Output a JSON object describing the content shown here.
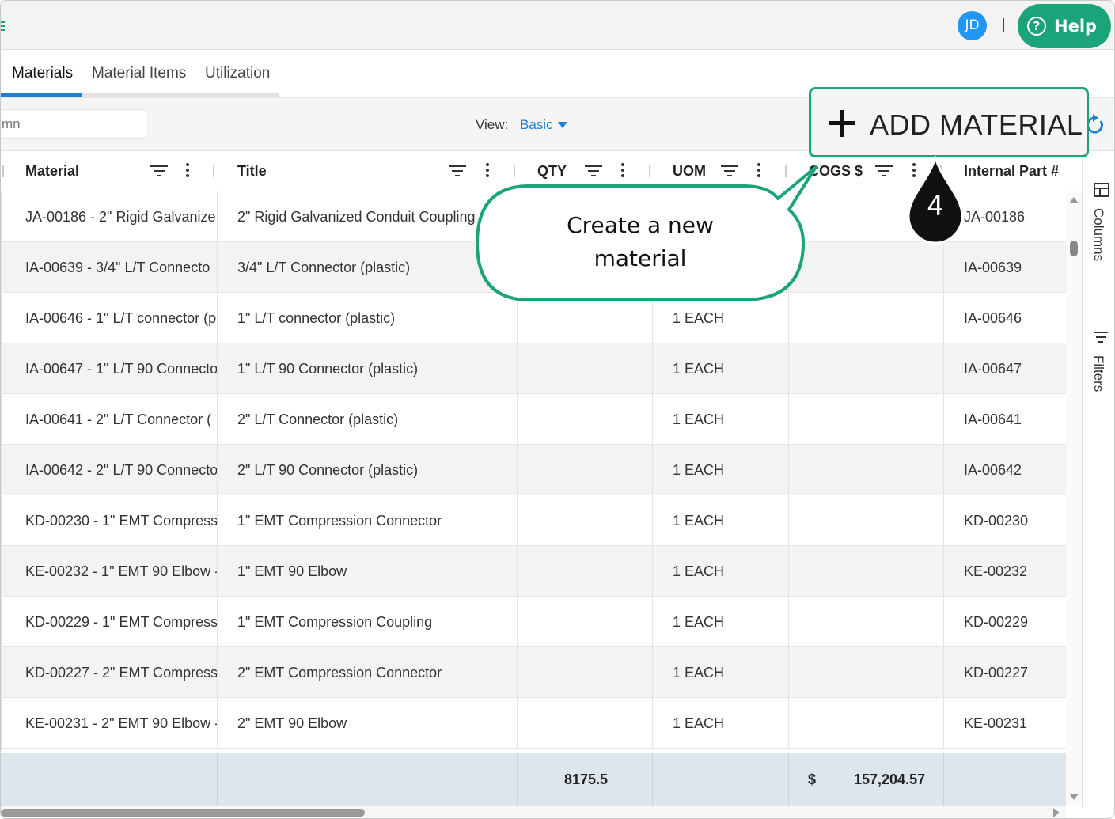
{
  "header": {
    "avatar_initials": "JD",
    "help_label": "Help"
  },
  "tabs": [
    {
      "label": "Materials",
      "active": true
    },
    {
      "label": "Material Items",
      "active": false
    },
    {
      "label": "Utilization",
      "active": false
    }
  ],
  "toolbar": {
    "search_placeholder": "mn",
    "view_label": "View:",
    "view_value": "Basic",
    "add_button_label": "ADD MATERIAL"
  },
  "columns": [
    "Material",
    "Title",
    "QTY",
    "UOM",
    "COGS $",
    "Internal Part #"
  ],
  "rows": [
    {
      "material": "JA-00186 - 2\" Rigid Galvanize",
      "title": "2\" Rigid Galvanized Conduit Coupling",
      "qty": "",
      "uom": "",
      "cogs": "",
      "part": "JA-00186"
    },
    {
      "material": "IA-00639 - 3/4\" L/T Connecto",
      "title": "3/4\" L/T Connector (plastic)",
      "qty": "",
      "uom": "",
      "cogs": "",
      "part": "IA-00639"
    },
    {
      "material": "IA-00646 - 1\" L/T connector (p",
      "title": "1\" L/T connector (plastic)",
      "qty": "",
      "uom": "1 EACH",
      "cogs": "",
      "part": "IA-00646"
    },
    {
      "material": "IA-00647 - 1\" L/T 90 Connecto",
      "title": "1\" L/T 90 Connector (plastic)",
      "qty": "",
      "uom": "1 EACH",
      "cogs": "",
      "part": "IA-00647"
    },
    {
      "material": "IA-00641 - 2\" L/T Connector (",
      "title": "2\" L/T Connector (plastic)",
      "qty": "",
      "uom": "1 EACH",
      "cogs": "",
      "part": "IA-00641"
    },
    {
      "material": "IA-00642 - 2\" L/T 90 Connecto",
      "title": "2\" L/T 90 Connector (plastic)",
      "qty": "",
      "uom": "1 EACH",
      "cogs": "",
      "part": "IA-00642"
    },
    {
      "material": "KD-00230 - 1\" EMT Compress",
      "title": "1\" EMT Compression Connector",
      "qty": "",
      "uom": "1 EACH",
      "cogs": "",
      "part": "KD-00230"
    },
    {
      "material": "KE-00232 - 1\" EMT 90 Elbow -",
      "title": "1\" EMT 90 Elbow",
      "qty": "",
      "uom": "1 EACH",
      "cogs": "",
      "part": "KE-00232"
    },
    {
      "material": "KD-00229 - 1\" EMT Compress",
      "title": "1\" EMT Compression Coupling",
      "qty": "",
      "uom": "1 EACH",
      "cogs": "",
      "part": "KD-00229"
    },
    {
      "material": "KD-00227 - 2\" EMT Compress",
      "title": "2\" EMT Compression Connector",
      "qty": "",
      "uom": "1 EACH",
      "cogs": "",
      "part": "KD-00227"
    },
    {
      "material": "KE-00231 - 2\" EMT 90 Elbow -",
      "title": "2\" EMT 90 Elbow",
      "qty": "",
      "uom": "1 EACH",
      "cogs": "",
      "part": "KE-00231"
    }
  ],
  "totals": {
    "qty": "8175.5",
    "currency": "$",
    "cogs": "157,204.57"
  },
  "side_panel": {
    "columns_label": "Columns",
    "filters_label": "Filters"
  },
  "callout": {
    "text_line1": "Create a new",
    "text_line2": "material",
    "step_number": "4"
  },
  "colors": {
    "accent_green": "#1ba37a",
    "link_blue": "#1a7fd6",
    "avatar_blue": "#2196f3",
    "footer_bg": "#dde6ed"
  }
}
